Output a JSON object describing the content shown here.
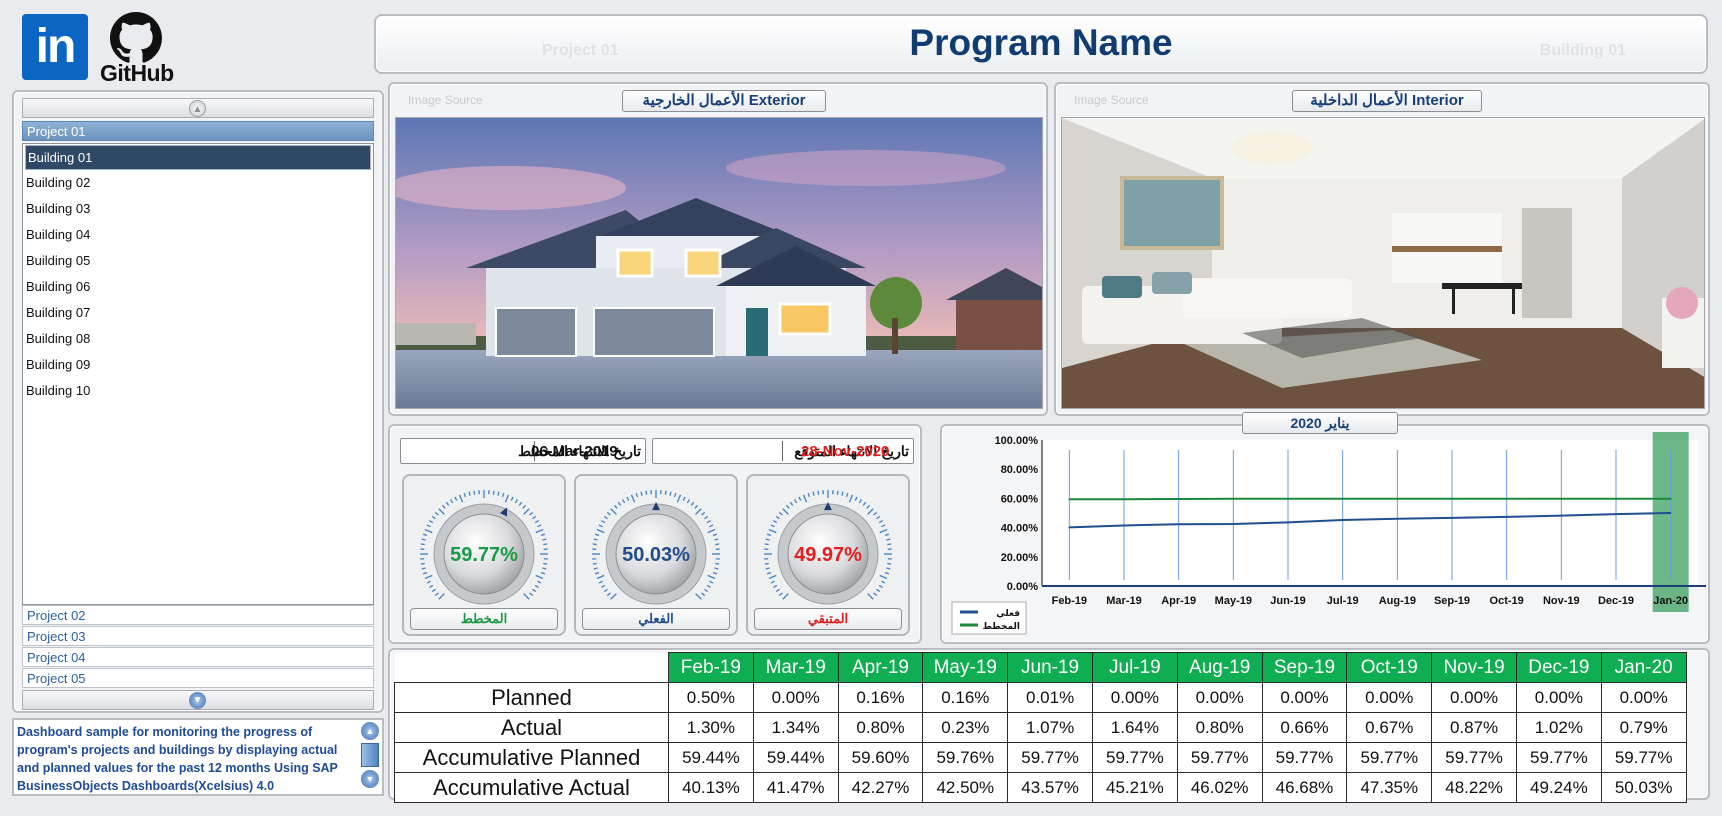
{
  "logos": {
    "linkedin": "in",
    "github": "GitHub"
  },
  "header": {
    "title": "Program Name",
    "ghost_left": "Project 01",
    "ghost_right": "Building 01"
  },
  "sidebar": {
    "active_project": "Project 01",
    "buildings": [
      "Building 01",
      "Building 02",
      "Building 03",
      "Building 04",
      "Building 05",
      "Building 06",
      "Building 07",
      "Building 08",
      "Building 09",
      "Building 10"
    ],
    "selected_building": "Building 01",
    "other_projects": [
      "Project 02",
      "Project 03",
      "Project 04",
      "Project 05"
    ]
  },
  "description": "Dashboard sample for monitoring the progress of program's projects and buildings by displaying actual and planned values for the past 12 months Using SAP BusinessObjects Dashboards(Xcelsius) 4.0",
  "exterior": {
    "source": "Image Source",
    "title": "الأعمال الخارجية Exterior"
  },
  "interior": {
    "source": "Image Source",
    "title": "الأعمال الداخلية Interior"
  },
  "dates": {
    "planned_label": "تاريخ الانتهاء المخطط",
    "planned_value": "06-Mar-2019",
    "expected_label": "تاريخ الانتهاء المتوقع",
    "expected_value": "28-Nov-2020"
  },
  "gauges": [
    {
      "pct": "59.77%",
      "label": "المخطط",
      "color": "#1a9a45",
      "value": 59.77
    },
    {
      "pct": "50.03%",
      "label": "الفعلي",
      "color": "#234d8a",
      "value": 50.03
    },
    {
      "pct": "49.97%",
      "label": "المتبقي",
      "color": "#e02020",
      "value": 49.97
    }
  ],
  "chart_title": "يناير 2020",
  "chart_data": {
    "type": "line",
    "categories": [
      "Feb-19",
      "Mar-19",
      "Apr-19",
      "May-19",
      "Jun-19",
      "Jul-19",
      "Aug-19",
      "Sep-19",
      "Oct-19",
      "Nov-19",
      "Dec-19",
      "Jan-20"
    ],
    "yticks": [
      "0.00%",
      "20.00%",
      "40.00%",
      "60.00%",
      "80.00%",
      "100.00%"
    ],
    "ylim": [
      0,
      100
    ],
    "highlight": "Jan-20",
    "series": [
      {
        "name": "فعلي",
        "color": "#1f4f8f",
        "values": [
          40.13,
          41.47,
          42.27,
          42.5,
          43.57,
          45.21,
          46.02,
          46.68,
          47.35,
          48.22,
          49.24,
          50.03
        ]
      },
      {
        "name": "المخطط",
        "color": "#1a8a3a",
        "values": [
          59.44,
          59.44,
          59.6,
          59.76,
          59.77,
          59.77,
          59.77,
          59.77,
          59.77,
          59.77,
          59.77,
          59.77
        ]
      }
    ]
  },
  "table": {
    "months": [
      "Feb-19",
      "Mar-19",
      "Apr-19",
      "May-19",
      "Jun-19",
      "Jul-19",
      "Aug-19",
      "Sep-19",
      "Oct-19",
      "Nov-19",
      "Dec-19",
      "Jan-20"
    ],
    "rows": [
      {
        "label": "Planned",
        "values": [
          "0.50%",
          "0.00%",
          "0.16%",
          "0.16%",
          "0.01%",
          "0.00%",
          "0.00%",
          "0.00%",
          "0.00%",
          "0.00%",
          "0.00%",
          "0.00%"
        ]
      },
      {
        "label": "Actual",
        "values": [
          "1.30%",
          "1.34%",
          "0.80%",
          "0.23%",
          "1.07%",
          "1.64%",
          "0.80%",
          "0.66%",
          "0.67%",
          "0.87%",
          "1.02%",
          "0.79%"
        ]
      },
      {
        "label": "Accumulative Planned",
        "values": [
          "59.44%",
          "59.44%",
          "59.60%",
          "59.76%",
          "59.77%",
          "59.77%",
          "59.77%",
          "59.77%",
          "59.77%",
          "59.77%",
          "59.77%",
          "59.77%"
        ]
      },
      {
        "label": "Accumulative Actual",
        "values": [
          "40.13%",
          "41.47%",
          "42.27%",
          "42.50%",
          "43.57%",
          "45.21%",
          "46.02%",
          "46.68%",
          "47.35%",
          "48.22%",
          "49.24%",
          "50.03%"
        ]
      }
    ]
  }
}
